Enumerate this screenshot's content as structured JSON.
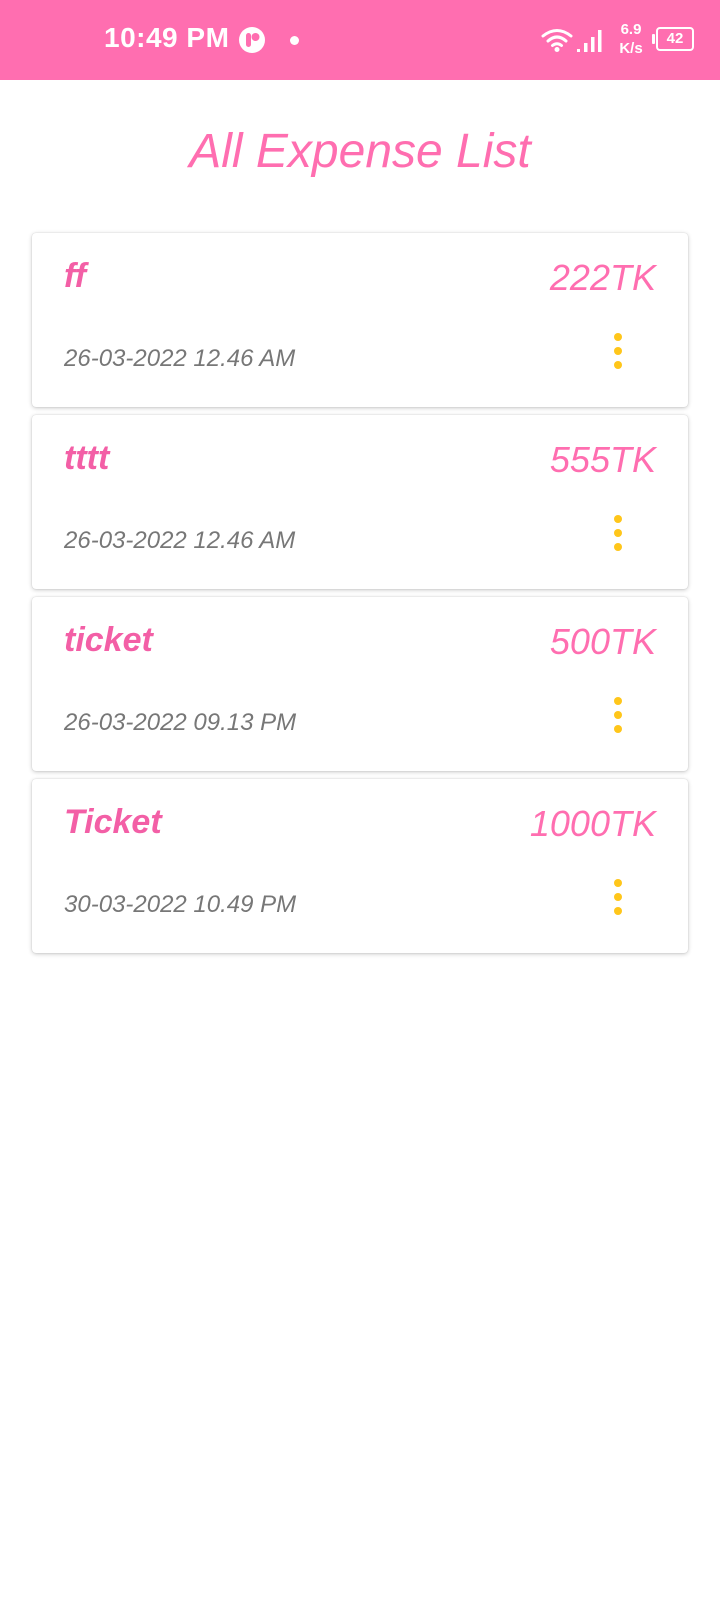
{
  "status_bar": {
    "time": "10:49 PM",
    "speed_value": "6.9",
    "speed_unit": "K/s",
    "battery": "42",
    "icons": [
      "app-icon",
      "notification-dot",
      "wifi-icon",
      "signal-icon",
      "battery-icon"
    ]
  },
  "page": {
    "title": "All Expense List"
  },
  "expenses": [
    {
      "name": "ff",
      "amount": "222",
      "currency": "TK",
      "date": "26-03-2022 12.46 AM"
    },
    {
      "name": "tttt",
      "amount": "555",
      "currency": "TK",
      "date": "26-03-2022 12.46 AM"
    },
    {
      "name": "ticket",
      "amount": "500",
      "currency": "TK",
      "date": "26-03-2022 09.13 PM"
    },
    {
      "name": "Ticket",
      "amount": "1000",
      "currency": "TK",
      "date": "30-03-2022 10.49 PM"
    }
  ],
  "colors": {
    "accent": "#ff6eb0",
    "menu_dots": "#ffc61a",
    "date_text": "#777777"
  }
}
